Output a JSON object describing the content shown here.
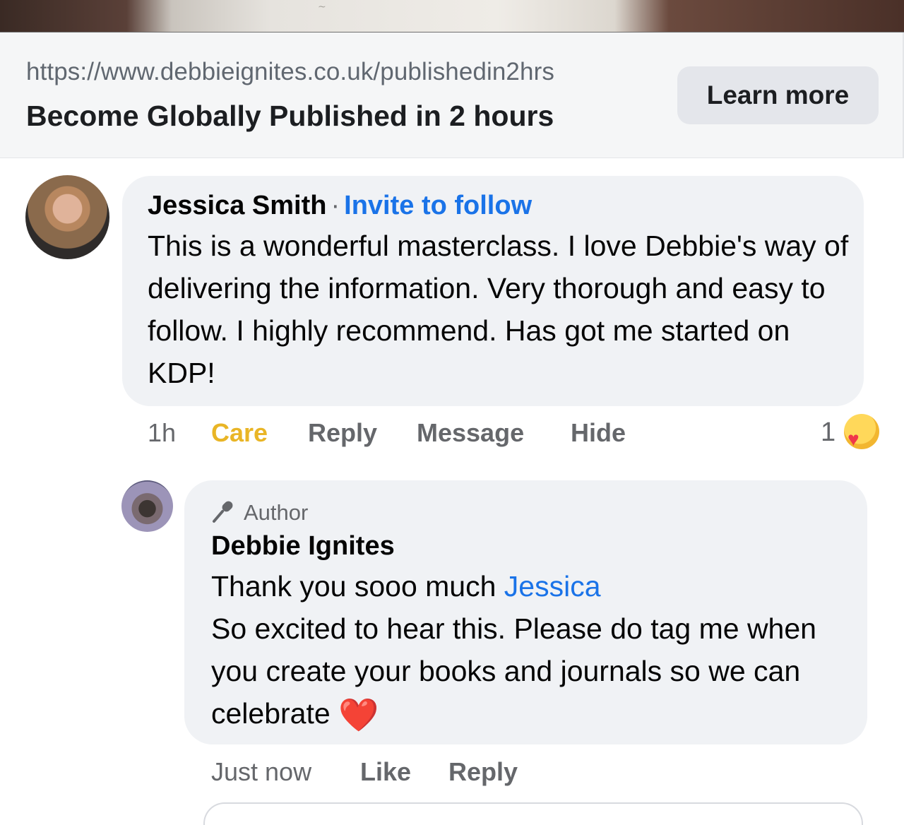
{
  "link_preview": {
    "url": "https://www.debbieignites.co.uk/publishedin2hrs",
    "title": "Become Globally Published in 2 hours",
    "cta_label": "Learn more"
  },
  "comment": {
    "author": "Jessica Smith",
    "separator": "·",
    "invite_label": "Invite to follow",
    "text": "This is a wonderful masterclass. I love Debbie's way of delivering the information. Very thorough and easy to follow. I highly recommend. Has got me started on KDP!",
    "time": "1h",
    "reaction_label": "Care",
    "reply_label": "Reply",
    "message_label": "Message",
    "hide_label": "Hide",
    "reaction_count": "1",
    "reaction_icon": "care-emoji"
  },
  "reply": {
    "badge_icon": "microphone-icon",
    "badge_label": "Author",
    "author": "Debbie Ignites",
    "line1_text": "Thank you sooo much ",
    "mention": "Jessica",
    "body": "So excited to hear this. Please do tag me when you create your books and journals so we can celebrate",
    "emoji": "❤️",
    "time": "Just now",
    "like_label": "Like",
    "reply_label": "Reply"
  },
  "colors": {
    "link_blue": "#1a73e8",
    "care_yellow": "#e9b526",
    "bubble_bg": "#f0f2f5",
    "meta_gray": "#65676b"
  }
}
